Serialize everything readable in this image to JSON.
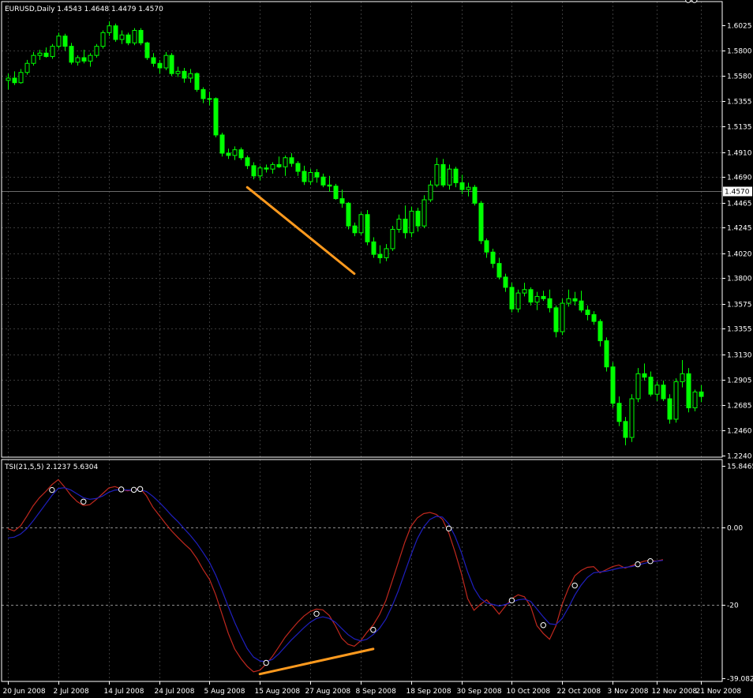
{
  "header": {
    "price_info": "EURUSD,Daily  1.4543 1.4648 1.4479 1.4570",
    "indicator_info": "TSI(21,5,5) 2.1237 5.6304"
  },
  "colors": {
    "background": "#000000",
    "bull_candle": "#000000",
    "bear_candle": "#00ff00",
    "candle_outline": "#00ff00",
    "grid": "#3a3a3a",
    "axis_text": "#ffffff",
    "tsi_line": "#c0281e",
    "signal_line": "#1f1fbf",
    "trendline": "#ff9a1e",
    "marker": "#ffffff"
  },
  "chart_data": [
    {
      "type": "candlestick",
      "symbol": "EURUSD",
      "timeframe": "Daily",
      "current_price_label": "1.4570",
      "current_price": 1.457,
      "ylim": [
        1.224,
        1.6025
      ],
      "y_ticks": [
        "1.6025",
        "1.5800",
        "1.5580",
        "1.5355",
        "1.5135",
        "1.4910",
        "1.4690",
        "1.4465",
        "1.4245",
        "1.4020",
        "1.3800",
        "1.3575",
        "1.3355",
        "1.3130",
        "1.2905",
        "1.2685",
        "1.2460",
        "1.2240"
      ],
      "y_tick_values": [
        1.6025,
        1.58,
        1.558,
        1.5355,
        1.5135,
        1.491,
        1.469,
        1.4465,
        1.4245,
        1.402,
        1.38,
        1.3575,
        1.3355,
        1.313,
        1.2905,
        1.2685,
        1.246,
        1.224
      ],
      "x_ticks": [
        "20 Jun 2008",
        "2 Jul 2008",
        "14 Jul 2008",
        "24 Jul 2008",
        "5 Aug 2008",
        "15 Aug 2008",
        "27 Aug 2008",
        "8 Sep 2008",
        "18 Sep 2008",
        "30 Sep 2008",
        "10 Oct 2008",
        "22 Oct 2008",
        "3 Nov 2008",
        "12 Nov 2008",
        "21 Nov 2008"
      ],
      "x_tick_bar_index": [
        0,
        8,
        16,
        24,
        32,
        40,
        48,
        56,
        64,
        72,
        80,
        88,
        96,
        103,
        110
      ],
      "candles": [
        [
          1.554,
          1.56,
          1.546,
          1.556
        ],
        [
          1.556,
          1.562,
          1.55,
          1.552
        ],
        [
          1.552,
          1.564,
          1.551,
          1.561
        ],
        [
          1.561,
          1.572,
          1.559,
          1.569
        ],
        [
          1.569,
          1.579,
          1.567,
          1.576
        ],
        [
          1.576,
          1.581,
          1.572,
          1.578
        ],
        [
          1.578,
          1.583,
          1.574,
          1.575
        ],
        [
          1.575,
          1.586,
          1.573,
          1.584
        ],
        [
          1.584,
          1.596,
          1.582,
          1.593
        ],
        [
          1.593,
          1.595,
          1.58,
          1.584
        ],
        [
          1.584,
          1.587,
          1.568,
          1.57
        ],
        [
          1.57,
          1.576,
          1.567,
          1.574
        ],
        [
          1.574,
          1.581,
          1.569,
          1.571
        ],
        [
          1.571,
          1.578,
          1.566,
          1.576
        ],
        [
          1.576,
          1.586,
          1.574,
          1.584
        ],
        [
          1.584,
          1.598,
          1.582,
          1.596
        ],
        [
          1.596,
          1.606,
          1.593,
          1.602
        ],
        [
          1.602,
          1.604,
          1.588,
          1.59
        ],
        [
          1.59,
          1.598,
          1.586,
          1.594
        ],
        [
          1.594,
          1.596,
          1.585,
          1.587
        ],
        [
          1.587,
          1.6,
          1.585,
          1.598
        ],
        [
          1.598,
          1.6,
          1.585,
          1.587
        ],
        [
          1.587,
          1.588,
          1.572,
          1.574
        ],
        [
          1.574,
          1.578,
          1.566,
          1.569
        ],
        [
          1.569,
          1.572,
          1.56,
          1.565
        ],
        [
          1.565,
          1.579,
          1.563,
          1.576
        ],
        [
          1.576,
          1.578,
          1.558,
          1.56
        ],
        [
          1.56,
          1.566,
          1.557,
          1.562
        ],
        [
          1.562,
          1.565,
          1.552,
          1.556
        ],
        [
          1.556,
          1.564,
          1.552,
          1.56
        ],
        [
          1.56,
          1.561,
          1.544,
          1.546
        ],
        [
          1.546,
          1.548,
          1.534,
          1.538
        ],
        [
          1.538,
          1.544,
          1.532,
          1.538
        ],
        [
          1.538,
          1.539,
          1.504,
          1.506
        ],
        [
          1.506,
          1.508,
          1.487,
          1.49
        ],
        [
          1.49,
          1.494,
          1.485,
          1.488
        ],
        [
          1.488,
          1.496,
          1.484,
          1.493
        ],
        [
          1.493,
          1.495,
          1.484,
          1.486
        ],
        [
          1.486,
          1.488,
          1.476,
          1.479
        ],
        [
          1.479,
          1.482,
          1.467,
          1.47
        ],
        [
          1.47,
          1.479,
          1.466,
          1.477
        ],
        [
          1.477,
          1.48,
          1.473,
          1.476
        ],
        [
          1.476,
          1.482,
          1.472,
          1.48
        ],
        [
          1.48,
          1.487,
          1.477,
          1.478
        ],
        [
          1.478,
          1.488,
          1.47,
          1.486
        ],
        [
          1.486,
          1.49,
          1.478,
          1.481
        ],
        [
          1.481,
          1.483,
          1.47,
          1.474
        ],
        [
          1.474,
          1.479,
          1.462,
          1.465
        ],
        [
          1.465,
          1.476,
          1.462,
          1.473
        ],
        [
          1.473,
          1.476,
          1.464,
          1.469
        ],
        [
          1.469,
          1.472,
          1.46,
          1.462
        ],
        [
          1.462,
          1.47,
          1.456,
          1.461
        ],
        [
          1.461,
          1.463,
          1.449,
          1.45
        ],
        [
          1.45,
          1.458,
          1.442,
          1.446
        ],
        [
          1.446,
          1.447,
          1.423,
          1.426
        ],
        [
          1.426,
          1.429,
          1.417,
          1.42
        ],
        [
          1.42,
          1.438,
          1.418,
          1.436
        ],
        [
          1.436,
          1.44,
          1.409,
          1.412
        ],
        [
          1.412,
          1.416,
          1.398,
          1.401
        ],
        [
          1.401,
          1.409,
          1.393,
          1.398
        ],
        [
          1.398,
          1.41,
          1.395,
          1.406
        ],
        [
          1.406,
          1.426,
          1.404,
          1.423
        ],
        [
          1.423,
          1.436,
          1.42,
          1.432
        ],
        [
          1.432,
          1.444,
          1.415,
          1.42
        ],
        [
          1.42,
          1.443,
          1.416,
          1.439
        ],
        [
          1.439,
          1.442,
          1.421,
          1.426
        ],
        [
          1.426,
          1.453,
          1.424,
          1.449
        ],
        [
          1.449,
          1.466,
          1.447,
          1.462
        ],
        [
          1.462,
          1.486,
          1.46,
          1.48
        ],
        [
          1.48,
          1.485,
          1.46,
          1.462
        ],
        [
          1.462,
          1.48,
          1.458,
          1.476
        ],
        [
          1.476,
          1.478,
          1.46,
          1.464
        ],
        [
          1.464,
          1.471,
          1.454,
          1.458
        ],
        [
          1.458,
          1.464,
          1.452,
          1.46
        ],
        [
          1.46,
          1.462,
          1.444,
          1.446
        ],
        [
          1.446,
          1.448,
          1.41,
          1.413
        ],
        [
          1.413,
          1.415,
          1.398,
          1.403
        ],
        [
          1.403,
          1.406,
          1.389,
          1.393
        ],
        [
          1.393,
          1.398,
          1.379,
          1.381
        ],
        [
          1.381,
          1.384,
          1.368,
          1.372
        ],
        [
          1.372,
          1.376,
          1.35,
          1.353
        ],
        [
          1.353,
          1.37,
          1.35,
          1.367
        ],
        [
          1.367,
          1.376,
          1.364,
          1.37
        ],
        [
          1.37,
          1.372,
          1.356,
          1.359
        ],
        [
          1.359,
          1.368,
          1.352,
          1.364
        ],
        [
          1.364,
          1.369,
          1.36,
          1.362
        ],
        [
          1.362,
          1.37,
          1.35,
          1.354
        ],
        [
          1.354,
          1.356,
          1.328,
          1.333
        ],
        [
          1.333,
          1.362,
          1.33,
          1.358
        ],
        [
          1.358,
          1.37,
          1.355,
          1.362
        ],
        [
          1.362,
          1.368,
          1.356,
          1.36
        ],
        [
          1.36,
          1.369,
          1.35,
          1.352
        ],
        [
          1.352,
          1.356,
          1.343,
          1.348
        ],
        [
          1.348,
          1.351,
          1.339,
          1.342
        ],
        [
          1.342,
          1.344,
          1.32,
          1.325
        ],
        [
          1.325,
          1.328,
          1.298,
          1.302
        ],
        [
          1.302,
          1.306,
          1.266,
          1.27
        ],
        [
          1.27,
          1.276,
          1.25,
          1.254
        ],
        [
          1.254,
          1.258,
          1.233,
          1.24
        ],
        [
          1.24,
          1.278,
          1.236,
          1.274
        ],
        [
          1.274,
          1.301,
          1.271,
          1.296
        ],
        [
          1.296,
          1.305,
          1.29,
          1.293
        ],
        [
          1.293,
          1.298,
          1.276,
          1.278
        ],
        [
          1.278,
          1.289,
          1.272,
          1.286
        ],
        [
          1.286,
          1.29,
          1.272,
          1.274
        ],
        [
          1.274,
          1.278,
          1.252,
          1.256
        ],
        [
          1.256,
          1.292,
          1.253,
          1.289
        ],
        [
          1.289,
          1.308,
          1.284,
          1.296
        ],
        [
          1.296,
          1.301,
          1.262,
          1.266
        ],
        [
          1.266,
          1.282,
          1.263,
          1.28
        ],
        [
          1.28,
          1.286,
          1.271,
          1.276
        ]
      ],
      "trendline": {
        "start_bar": 38,
        "start_price": 1.46,
        "end_bar": 55,
        "end_price": 1.384
      }
    },
    {
      "type": "line",
      "title": "TSI(21,5,5) 2.1237 5.6304",
      "ylim": [
        -39.0822,
        15.8465
      ],
      "y_ticks": [
        "15.8465",
        "0.00",
        "-20",
        "-39.0822"
      ],
      "y_tick_values": [
        15.8465,
        0,
        -20,
        -39.0822
      ],
      "series": [
        {
          "values": [
            -0.4,
            -1.0,
            0.3,
            2.8,
            5.5,
            7.6,
            9.2,
            11.0,
            12.3,
            10.4,
            8.2,
            6.6,
            5.6,
            5.8,
            7.1,
            8.6,
            10.1,
            10.5,
            9.8,
            9.4,
            9.7,
            10.0,
            8.1,
            5.2,
            3.1,
            1.0,
            -1.0,
            -2.7,
            -4.3,
            -5.8,
            -8.1,
            -11.0,
            -13.5,
            -17.5,
            -22.5,
            -27.5,
            -31.5,
            -34.0,
            -36.0,
            -37.4,
            -37.0,
            -35.4,
            -33.4,
            -31.0,
            -28.5,
            -26.5,
            -24.6,
            -23.0,
            -21.8,
            -21.2,
            -21.4,
            -22.8,
            -25.5,
            -28.7,
            -30.3,
            -30.8,
            -29.4,
            -27.2,
            -25.3,
            -22.6,
            -19.0,
            -14.0,
            -9.0,
            -4.0,
            0.2,
            2.4,
            3.5,
            3.8,
            3.3,
            2.0,
            -1.5,
            -6.5,
            -12.0,
            -18.5,
            -21.5,
            -20.0,
            -18.8,
            -20.5,
            -22.5,
            -20.4,
            -18.5,
            -17.5,
            -18.0,
            -20.5,
            -25.5,
            -27.5,
            -29.0,
            -25.5,
            -20.0,
            -15.8,
            -12.6,
            -11.2,
            -10.4,
            -10.2,
            -11.8,
            -11.0,
            -10.2,
            -9.8,
            -10.6,
            -10.0,
            -9.4,
            -8.8,
            -8.6,
            -8.8,
            -8.4
          ],
          "color": "#c0281e"
        },
        {
          "values": [
            -2.8,
            -2.6,
            -1.8,
            -0.4,
            1.6,
            3.8,
            6.0,
            8.2,
            10.0,
            10.2,
            9.6,
            8.6,
            7.6,
            7.2,
            7.4,
            8.0,
            9.0,
            9.6,
            9.7,
            9.6,
            9.6,
            9.7,
            9.2,
            8.0,
            6.5,
            4.8,
            3.0,
            1.4,
            -0.4,
            -2.2,
            -4.2,
            -6.6,
            -9.1,
            -12.4,
            -16.4,
            -20.6,
            -24.6,
            -28.2,
            -31.4,
            -33.6,
            -34.6,
            -34.8,
            -34.2,
            -32.8,
            -31.0,
            -29.2,
            -27.6,
            -26.0,
            -24.6,
            -23.6,
            -23.2,
            -23.6,
            -24.6,
            -26.2,
            -27.8,
            -28.9,
            -29.4,
            -29.0,
            -27.8,
            -26.2,
            -23.8,
            -20.4,
            -16.4,
            -11.8,
            -7.2,
            -3.0,
            0.0,
            2.0,
            2.8,
            2.6,
            0.8,
            -2.4,
            -6.6,
            -11.6,
            -15.8,
            -18.4,
            -19.6,
            -20.0,
            -20.4,
            -20.0,
            -19.4,
            -18.8,
            -18.6,
            -19.2,
            -21.2,
            -23.2,
            -25.0,
            -25.2,
            -23.6,
            -20.8,
            -17.6,
            -15.0,
            -13.0,
            -11.8,
            -11.6,
            -11.4,
            -11.0,
            -10.6,
            -10.4,
            -10.2,
            -9.8,
            -9.4,
            -9.0,
            -8.8,
            -8.6
          ],
          "color": "#1f1fbf"
        }
      ],
      "markers_bar_index": [
        7,
        12,
        18,
        20,
        21,
        41,
        49,
        58,
        70,
        80,
        85,
        90,
        100,
        102,
        108,
        109
      ],
      "trendline": {
        "start_bar": 40,
        "start_value": -38.0,
        "end_bar": 58,
        "end_value": -31.5
      }
    }
  ]
}
